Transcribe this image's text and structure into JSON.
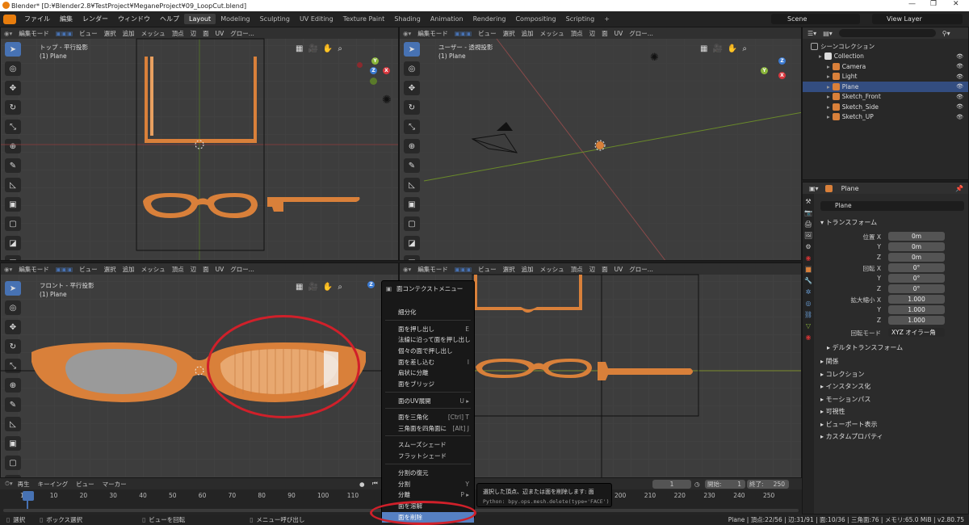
{
  "window_title": "Blender* [D:¥Blender2.8¥TestProject¥MeganeProject¥09_LoopCut.blend]",
  "menu": [
    "ファイル",
    "編集",
    "レンダー",
    "ウィンドウ",
    "ヘルプ"
  ],
  "workspaces": [
    "Layout",
    "Modeling",
    "Sculpting",
    "UV Editing",
    "Texture Paint",
    "Shading",
    "Animation",
    "Rendering",
    "Compositing",
    "Scripting"
  ],
  "active_workspace": "Layout",
  "scene_label": "Scene",
  "view_layer_label": "View Layer",
  "viewport_header": {
    "mode": "編集モード",
    "view": "ビュー",
    "select": "選択",
    "add": "追加",
    "mesh": "メッシュ",
    "vertex": "頂点",
    "edge": "辺",
    "face": "面",
    "uv": "UV",
    "orientation": "グロー..."
  },
  "viewports": {
    "top_left": {
      "title": "トップ - 平行投影",
      "object": "(1) Plane"
    },
    "top_right": {
      "title": "ユーザー - 透視投影",
      "object": "(1) Plane"
    },
    "bottom_left": {
      "title": "フロント - 平行投影",
      "object": "(1) Plane"
    }
  },
  "outliner": {
    "scene_collection": "シーンコレクション",
    "items": [
      {
        "name": "Collection",
        "indent": 1
      },
      {
        "name": "Camera",
        "indent": 2
      },
      {
        "name": "Light",
        "indent": 2
      },
      {
        "name": "Plane",
        "indent": 2,
        "selected": true
      },
      {
        "name": "Sketch_Front",
        "indent": 2
      },
      {
        "name": "Sketch_Side",
        "indent": 2
      },
      {
        "name": "Sketch_UP",
        "indent": 2
      }
    ]
  },
  "properties": {
    "object_name": "Plane",
    "object_field": "Plane",
    "transform_header": "トランスフォーム",
    "location_label": "位置 X",
    "rotation_label": "回転 X",
    "scale_label": "拡大縮小 X",
    "y_label": "Y",
    "z_label": "Z",
    "location": [
      "0m",
      "0m",
      "0m"
    ],
    "rotation": [
      "0°",
      "0°",
      "0°"
    ],
    "scale": [
      "1.000",
      "1.000",
      "1.000"
    ],
    "rotation_mode_label": "回転モード",
    "rotation_mode": "XYZ オイラー角",
    "delta": "デルタトランスフォーム",
    "sections": [
      "関係",
      "コレクション",
      "インスタンス化",
      "モーションパス",
      "可視性",
      "ビューポート表示",
      "カスタムプロパティ"
    ]
  },
  "context_menu": {
    "title": "面コンテクストメニュー",
    "items": [
      {
        "label": "細分化",
        "shortcut": ""
      },
      {
        "label": "面を押し出し",
        "shortcut": "E"
      },
      {
        "label": "法線に沿って面を押し出し",
        "shortcut": ""
      },
      {
        "label": "個々の面で押し出し",
        "shortcut": ""
      },
      {
        "label": "面を差し込む",
        "shortcut": "I"
      },
      {
        "label": "扇状に分離",
        "shortcut": ""
      },
      {
        "label": "面をブリッジ",
        "shortcut": ""
      },
      {
        "label": "面のUV展開",
        "shortcut": "U ▸"
      },
      {
        "label": "面を三角化",
        "shortcut": "[Ctrl] T"
      },
      {
        "label": "三角面を四角面に",
        "shortcut": "[Alt] J"
      },
      {
        "label": "スムーズシェード",
        "shortcut": ""
      },
      {
        "label": "フラットシェード",
        "shortcut": ""
      },
      {
        "label": "分割の復元",
        "shortcut": ""
      },
      {
        "label": "分割",
        "shortcut": "Y"
      },
      {
        "label": "分離",
        "shortcut": "P ▸"
      },
      {
        "label": "面を溶解",
        "shortcut": ""
      },
      {
        "label": "面を削除",
        "shortcut": "",
        "highlighted": true
      }
    ]
  },
  "tooltip": {
    "line1": "選択した頂点、辺または面を削除します: 面",
    "line2": "Python: bpy.ops.mesh.delete(type='FACE')"
  },
  "timeline": {
    "playback": "再生",
    "keying": "キーイング",
    "view": "ビュー",
    "marker": "マーカー",
    "current_frame": "1",
    "start_label": "開始:",
    "start": "1",
    "end_label": "終了:",
    "end": "250",
    "ticks": [
      "1",
      "10",
      "20",
      "30",
      "40",
      "50",
      "60",
      "70",
      "80",
      "90",
      "100",
      "110",
      "160",
      "170",
      "180",
      "190",
      "200",
      "210",
      "220",
      "230",
      "240",
      "250"
    ]
  },
  "status": {
    "select": "選択",
    "box_select": "ボックス選択",
    "rotate_view": "ビューを回転",
    "call_menu": "メニュー呼び出し",
    "stats": "Plane | 頂点:22/56 | 辺:31/91 | 面:10/36 | 三角面:76 | メモリ:65.0 MiB | v2.80.75"
  },
  "colors": {
    "accent": "#4772b3",
    "orange": "#d9803a",
    "highlight": "#5680c2",
    "annotation": "#d0202a"
  }
}
